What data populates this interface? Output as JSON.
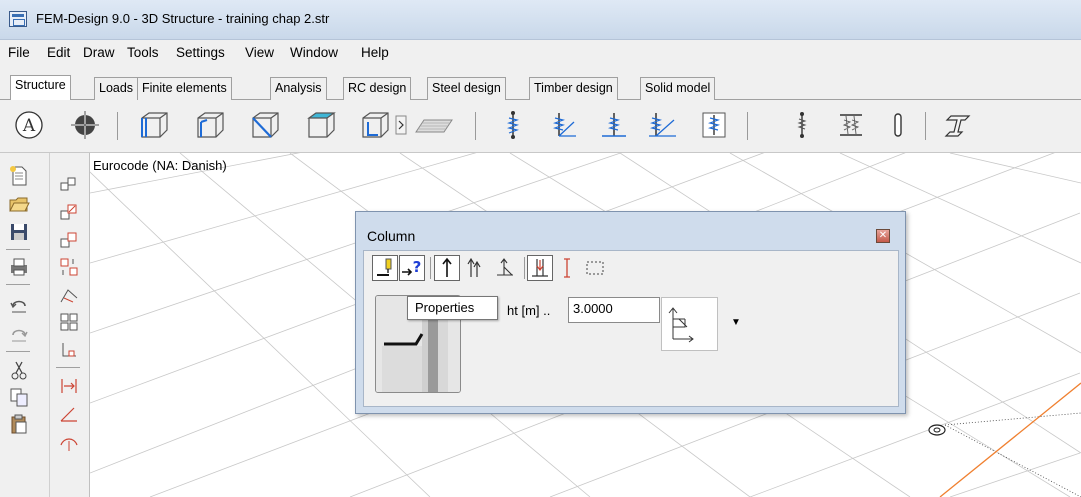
{
  "window": {
    "title": "FEM-Design 9.0 - 3D Structure - training chap 2.str"
  },
  "menu": [
    "File",
    "Edit",
    "Draw",
    "Tools",
    "Settings",
    "View",
    "Window",
    "Help"
  ],
  "tabs": [
    "Structure",
    "Loads",
    "Finite elements",
    "Analysis",
    "RC design",
    "Steel design",
    "Timber design",
    "Solid model"
  ],
  "active_tab": "Structure",
  "toolbar_icons": [
    "axis-a-icon",
    "origin-crosshair-icon",
    "box-frame-icon",
    "box-wall-icon",
    "box-diagonal-icon",
    "box-filled-top-icon",
    "box-open-icon",
    "more-arrow-icon",
    "slab-icon",
    "column-spring-icon",
    "support-angle-icon",
    "support-point-icon",
    "support-angle-line-icon",
    "support-framed-icon",
    "column-small-icon",
    "beam-spring-icon",
    "column-bar-icon",
    "steel-profile-icon"
  ],
  "canvas": {
    "code_label": "Eurocode (NA: Danish)"
  },
  "dialog": {
    "title": "Column",
    "close_glyph": "✕",
    "height_label": "ht [m] ..",
    "height_value": "3.0000",
    "dropdown_glyph": "▼"
  },
  "tooltip": {
    "text": "Properties"
  },
  "colors": {
    "title_bar": "#dfe9f5",
    "dialog_frame": "#cfdcec",
    "grid_line": "#c8c8c8",
    "accent_blue": "#1e6bd6",
    "axis_orange": "#f08030"
  }
}
